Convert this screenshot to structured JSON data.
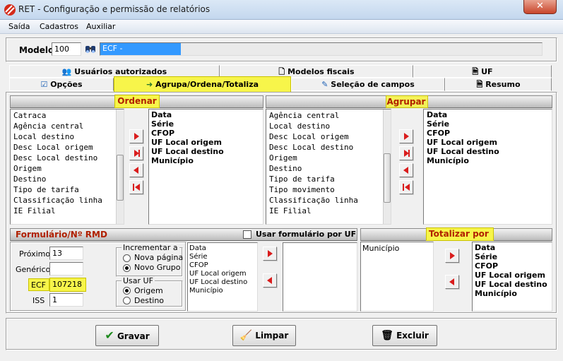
{
  "window": {
    "title": "RET - Configuração e permissão de relatórios",
    "close_glyph": "✕"
  },
  "menu": [
    "Saída",
    "Cadastros",
    "Auxiliar"
  ],
  "modelo": {
    "label": "Modelo",
    "value": "100",
    "field_value": "ECF -"
  },
  "tabs_row1": [
    "Usuários autorizados",
    "Modelos fiscais",
    "UF"
  ],
  "tabs_row2": [
    "Opções",
    "Agrupa/Ordena/Totaliza",
    "Seleção de campos",
    "Resumo"
  ],
  "ordenar": {
    "title": "Ordenar",
    "available": [
      "Catraca",
      "Agência central",
      "Local destino",
      "Desc Local origem",
      "Desc Local destino",
      "Origem",
      "Destino",
      "Tipo de tarifa",
      "Classificação linha",
      "IE Filial"
    ],
    "selected": [
      "Data",
      "Série",
      "CFOP",
      "UF Local origem",
      "UF Local destino",
      "Município"
    ]
  },
  "agrupar": {
    "title": "Agrupar",
    "available": [
      "Agência central",
      "Local destino",
      "Desc Local origem",
      "Desc Local destino",
      "Origem",
      "Destino",
      "Tipo de tarifa",
      "Tipo movimento",
      "Classificação linha",
      "IE Filial"
    ],
    "selected": [
      "Data",
      "Série",
      "CFOP",
      "UF Local origem",
      "UF Local destino",
      "Município"
    ]
  },
  "formulario": {
    "title": "Formulário/Nº RMD",
    "usar_label": "Usar formulário por UF",
    "proximo_label": "Próximo",
    "proximo_value": "13",
    "generico_label": "Genérico",
    "generico_value": "",
    "ecf_label": "ECF",
    "ecf_value": "107218",
    "iss_label": "ISS",
    "iss_value": "1",
    "incrementar_label": "Incrementar a",
    "incrementar_options": [
      "Nova página",
      "Novo Grupo"
    ],
    "usar_uf_label": "Usar UF",
    "usar_uf_options": [
      "Origem",
      "Destino"
    ],
    "fields": [
      "Data",
      "Série",
      "CFOP",
      "UF Local origem",
      "UF Local destino",
      "Município"
    ]
  },
  "totalizar": {
    "title": "Totalizar por",
    "available": [
      "Município"
    ],
    "selected": [
      "Data",
      "Série",
      "CFOP",
      "UF Local origem",
      "UF Local destino",
      "Município"
    ]
  },
  "buttons": {
    "gravar": "Gravar",
    "limpar": "Limpar",
    "excluir": "Excluir"
  },
  "colors": {
    "highlight": "#f7f54a",
    "section_title": "#b02000",
    "selection": "#3399ff",
    "arrow": "#d91c1c"
  }
}
